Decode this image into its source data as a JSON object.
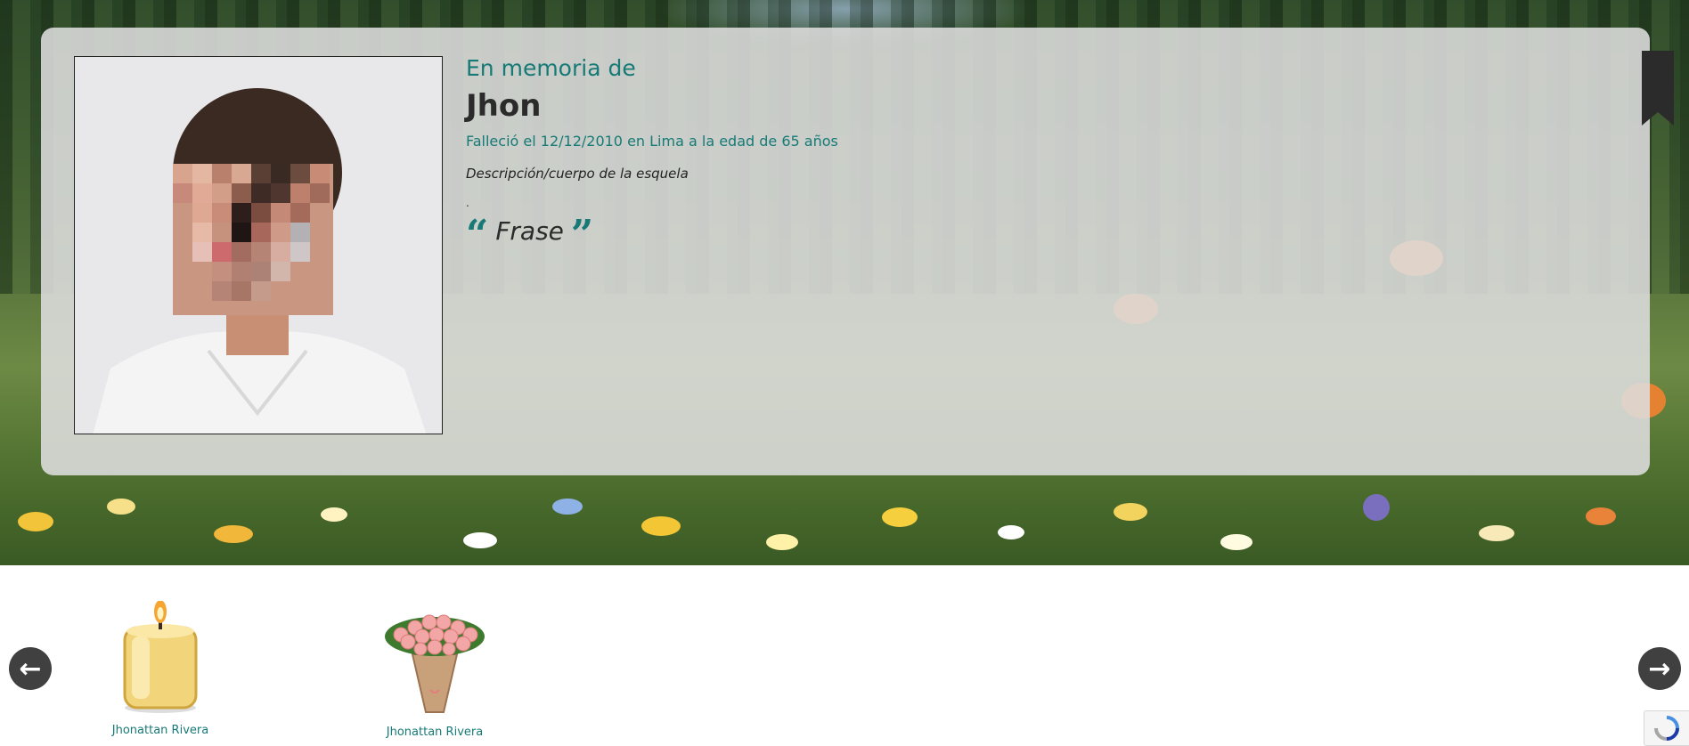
{
  "memorial": {
    "heading": "En memoria de",
    "name": "Jhon",
    "death_info": "Falleció el 12/12/2010 en Lima a la edad de 65 años",
    "description": "Descripción/cuerpo de la esquela",
    "dot": ".",
    "quote_open": "“",
    "phrase": "Frase",
    "quote_close": "”"
  },
  "tributes": [
    {
      "icon": "candle-icon",
      "author": "Jhonattan Rivera"
    },
    {
      "icon": "flower-bouquet-icon",
      "author": "Jhonattan Rivera"
    }
  ],
  "carousel": {
    "prev_icon": "arrow-left-icon",
    "next_icon": "arrow-right-icon"
  },
  "colors": {
    "accent": "#177a76",
    "text_dark": "#2b2b2b",
    "card": "#dedede",
    "nav": "#404040"
  }
}
